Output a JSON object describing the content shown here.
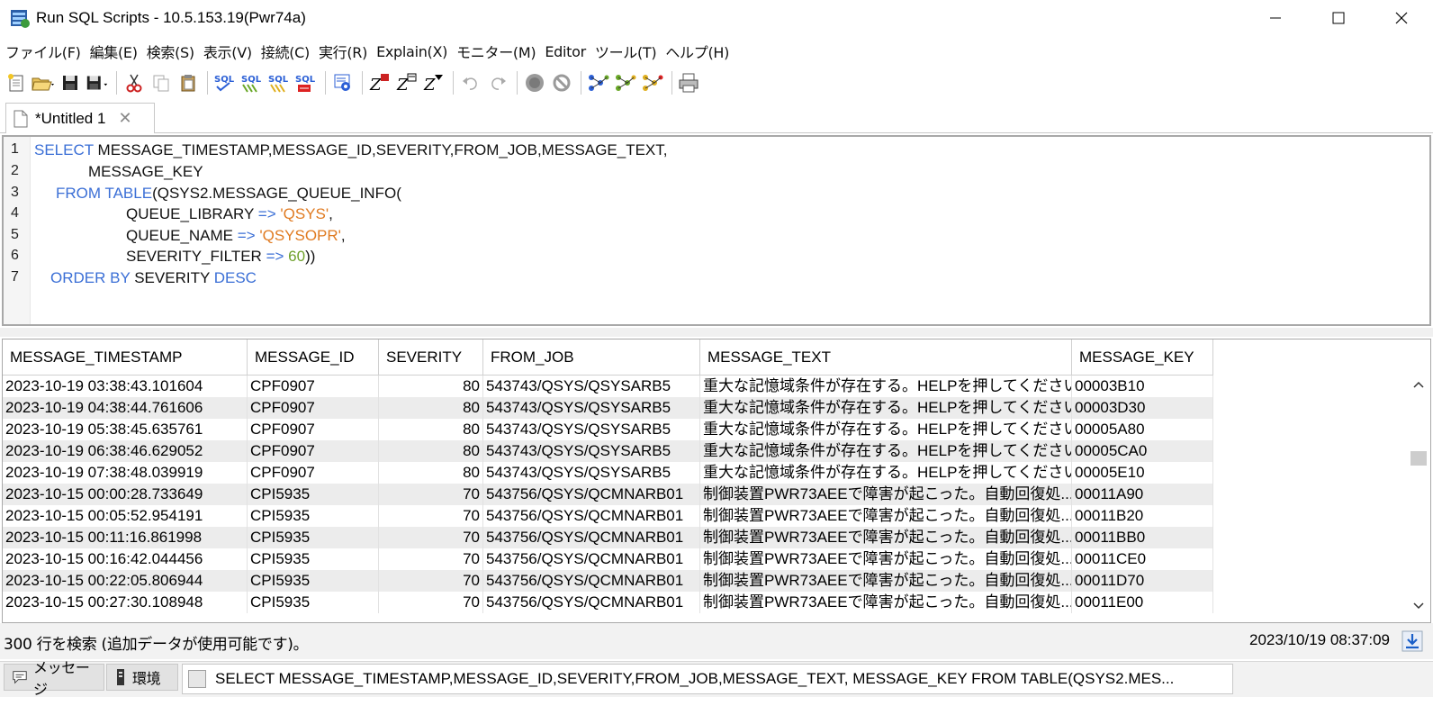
{
  "window": {
    "title": "Run SQL Scripts - 10.5.153.19(Pwr74a)"
  },
  "menu": [
    "ファイル(F)",
    "編集(E)",
    "検索(S)",
    "表示(V)",
    "接続(C)",
    "実行(R)",
    "Explain(X)",
    "モニター(M)",
    "Editor",
    "ツール(T)",
    "ヘルプ(H)"
  ],
  "toolbar": {
    "icons": [
      "new-script-icon",
      "open-icon",
      "save-icon",
      "save-as-icon",
      "cut-icon",
      "copy-icon",
      "paste-icon",
      "run-sql-icon",
      "run-sql-all-icon",
      "run-sql-from-icon",
      "run-sql-selected-icon",
      "run-settings-icon",
      "explain-icon",
      "explain-run-icon",
      "explain-all-icon",
      "undo-icon",
      "redo-icon",
      "stop-icon",
      "cancel-icon",
      "visual-explain-icon",
      "visual-explain-run-icon",
      "visual-explain-all-icon",
      "print-icon"
    ]
  },
  "editor": {
    "tab_label": "*Untitled 1",
    "line_numbers": [
      "1",
      "2",
      "3",
      "4",
      "5",
      "6",
      "7"
    ]
  },
  "sql": {
    "l1_kw": "SELECT",
    "l1_rest": " MESSAGE_TIMESTAMP,MESSAGE_ID,SEVERITY,FROM_JOB,MESSAGE_TEXT,",
    "l2": "MESSAGE_KEY",
    "l3_kw1": "FROM",
    "l3_kw2": "TABLE",
    "l3_rest": "(QSYS2.MESSAGE_QUEUE_INFO(",
    "l4_name": "QUEUE_LIBRARY ",
    "l4_op": "=>",
    "l4_val": "'QSYS'",
    "l4_end": ",",
    "l5_name": "QUEUE_NAME ",
    "l5_op": "=>",
    "l5_val": "'QSYSOPR'",
    "l5_end": ",",
    "l6_name": "SEVERITY_FILTER ",
    "l6_op": "=>",
    "l6_val": "60",
    "l6_end": "))",
    "l7_kw1": "ORDER BY",
    "l7_mid": " SEVERITY ",
    "l7_kw2": "DESC"
  },
  "grid": {
    "columns": [
      "MESSAGE_TIMESTAMP",
      "MESSAGE_ID",
      "SEVERITY",
      "FROM_JOB",
      "MESSAGE_TEXT",
      "MESSAGE_KEY"
    ],
    "rows": [
      [
        "2023-10-19 03:38:43.101604",
        "CPF0907",
        "80",
        "543743/QSYS/QSYSARB5",
        "重大な記憶域条件が存在する。HELPを押してください。",
        "00003B10"
      ],
      [
        "2023-10-19 04:38:44.761606",
        "CPF0907",
        "80",
        "543743/QSYS/QSYSARB5",
        "重大な記憶域条件が存在する。HELPを押してください。",
        "00003D30"
      ],
      [
        "2023-10-19 05:38:45.635761",
        "CPF0907",
        "80",
        "543743/QSYS/QSYSARB5",
        "重大な記憶域条件が存在する。HELPを押してください。",
        "00005A80"
      ],
      [
        "2023-10-19 06:38:46.629052",
        "CPF0907",
        "80",
        "543743/QSYS/QSYSARB5",
        "重大な記憶域条件が存在する。HELPを押してください。",
        "00005CA0"
      ],
      [
        "2023-10-19 07:38:48.039919",
        "CPF0907",
        "80",
        "543743/QSYS/QSYSARB5",
        "重大な記憶域条件が存在する。HELPを押してください。",
        "00005E10"
      ],
      [
        "2023-10-15 00:00:28.733649",
        "CPI5935",
        "70",
        "543756/QSYS/QCMNARB01",
        "制御装置PWR73AEEで障害が起こった。自動回復処...",
        "00011A90"
      ],
      [
        "2023-10-15 00:05:52.954191",
        "CPI5935",
        "70",
        "543756/QSYS/QCMNARB01",
        "制御装置PWR73AEEで障害が起こった。自動回復処...",
        "00011B20"
      ],
      [
        "2023-10-15 00:11:16.861998",
        "CPI5935",
        "70",
        "543756/QSYS/QCMNARB01",
        "制御装置PWR73AEEで障害が起こった。自動回復処...",
        "00011BB0"
      ],
      [
        "2023-10-15 00:16:42.044456",
        "CPI5935",
        "70",
        "543756/QSYS/QCMNARB01",
        "制御装置PWR73AEEで障害が起こった。自動回復処...",
        "00011CE0"
      ],
      [
        "2023-10-15 00:22:05.806944",
        "CPI5935",
        "70",
        "543756/QSYS/QCMNARB01",
        "制御装置PWR73AEEで障害が起こった。自動回復処...",
        "00011D70"
      ],
      [
        "2023-10-15 00:27:30.108948",
        "CPI5935",
        "70",
        "543756/QSYS/QCMNARB01",
        "制御装置PWR73AEEで障害が起こった。自動回復処...",
        "00011E00"
      ]
    ]
  },
  "status": {
    "text": "300 行を検索 (追加データが使用可能です)。",
    "timestamp": "2023/10/19 08:37:09"
  },
  "bottom_tabs": {
    "messages": "メッセージ",
    "environment": "環境",
    "sql_tab": "SELECT MESSAGE_TIMESTAMP,MESSAGE_ID,SEVERITY,FROM_JOB,MESSAGE_TEXT, MESSAGE_KEY FROM TABLE(QSYS2.MES..."
  },
  "colors": {
    "keyword": "#3b6fd6",
    "string": "#e07b22",
    "number": "#6ea02a",
    "row_alt": "#ececec"
  }
}
